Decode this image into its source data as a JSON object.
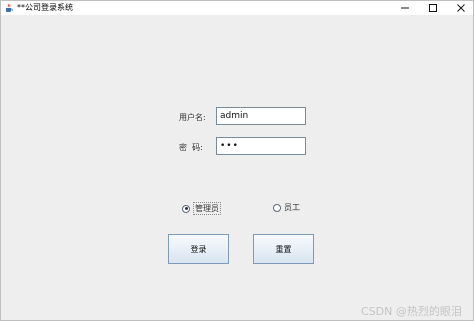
{
  "window": {
    "title": "**公司登录系统",
    "icons": {
      "app": "java-cup-icon",
      "minimize": "minimize-icon",
      "maximize": "maximize-icon",
      "close": "close-icon"
    }
  },
  "form": {
    "username_label": "用户名:",
    "username_value": "admin",
    "password_label": "密  码:",
    "password_value": "•••"
  },
  "roles": [
    {
      "label": "管理员",
      "selected": true
    },
    {
      "label": "员工",
      "selected": false
    }
  ],
  "buttons": {
    "login": "登录",
    "reset": "重置"
  },
  "watermark": "CSDN @热烈的眼泪",
  "colors": {
    "window_bg": "#eeeeee",
    "button_border": "#7e9ab6",
    "field_border": "#7a8a99"
  }
}
